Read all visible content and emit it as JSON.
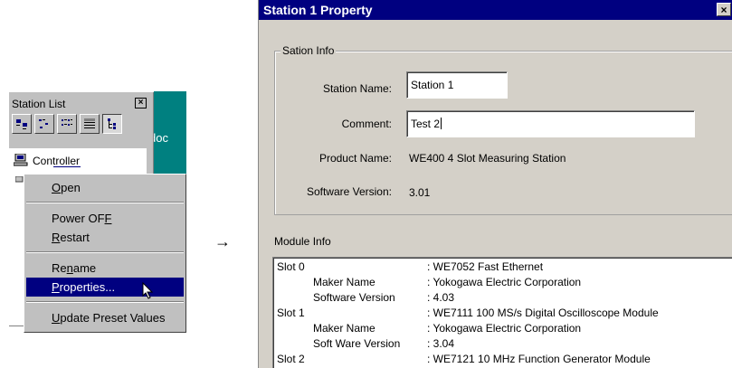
{
  "station_list": {
    "title": "Station List",
    "close_glyph": "×",
    "teal_text": "doc",
    "tree": [
      {
        "label": "Controller",
        "icon": "computer-icon"
      }
    ],
    "toolbar_icons": [
      "large-icons-view-icon",
      "small-icons-view-icon",
      "list-view-icon",
      "details-view-icon",
      "tree-view-icon"
    ]
  },
  "context_menu": {
    "items": [
      {
        "label": "Open",
        "accel": "O",
        "rest": "pen"
      },
      {
        "label": "Power OFF",
        "accel": "",
        "rest": ""
      },
      {
        "label": "Restart",
        "accel": "R",
        "rest": "estart"
      },
      {
        "label": "Rename",
        "accel": "",
        "rest": ""
      },
      {
        "label": "Properties...",
        "accel": "P",
        "rest": "roperties..."
      },
      {
        "label": "Update Preset Values",
        "accel": "U",
        "rest": "pdate Preset Values"
      }
    ]
  },
  "arrow": "→",
  "dialog": {
    "title": "Station 1 Property",
    "close_glyph": "×",
    "group_title": "Sation Info",
    "station_name_label": "Station Name:",
    "station_name_value": "Station 1",
    "comment_label": "Comment:",
    "comment_value": "Test 2",
    "product_name_label": "Product Name:",
    "product_name_value": "WE400 4 Slot Measuring Station",
    "software_version_label": "Software Version:",
    "software_version_value": "3.01",
    "module_info_label": "Module Info",
    "module_info_rows": [
      {
        "key": "Slot 0",
        "value": ": WE7052 Fast Ethernet",
        "indent": false
      },
      {
        "key": "Maker Name",
        "value": ": Yokogawa Electric Corporation",
        "indent": true
      },
      {
        "key": "Software Version",
        "value": ": 4.03",
        "indent": true
      },
      {
        "key": "Slot 1",
        "value": ": WE7111 100 MS/s Digital Oscilloscope Module",
        "indent": false
      },
      {
        "key": "Maker Name",
        "value": ": Yokogawa Electric Corporation",
        "indent": true
      },
      {
        "key": "Soft Ware Version",
        "value": ": 3.04",
        "indent": true
      },
      {
        "key": "Slot 2",
        "value": ": WE7121 10 MHz Function Generator Module",
        "indent": false
      }
    ]
  },
  "colors": {
    "title_bar": "#000080",
    "selection": "#000080",
    "panel": "#c0c0c0",
    "desktop_teal": "#008080"
  }
}
